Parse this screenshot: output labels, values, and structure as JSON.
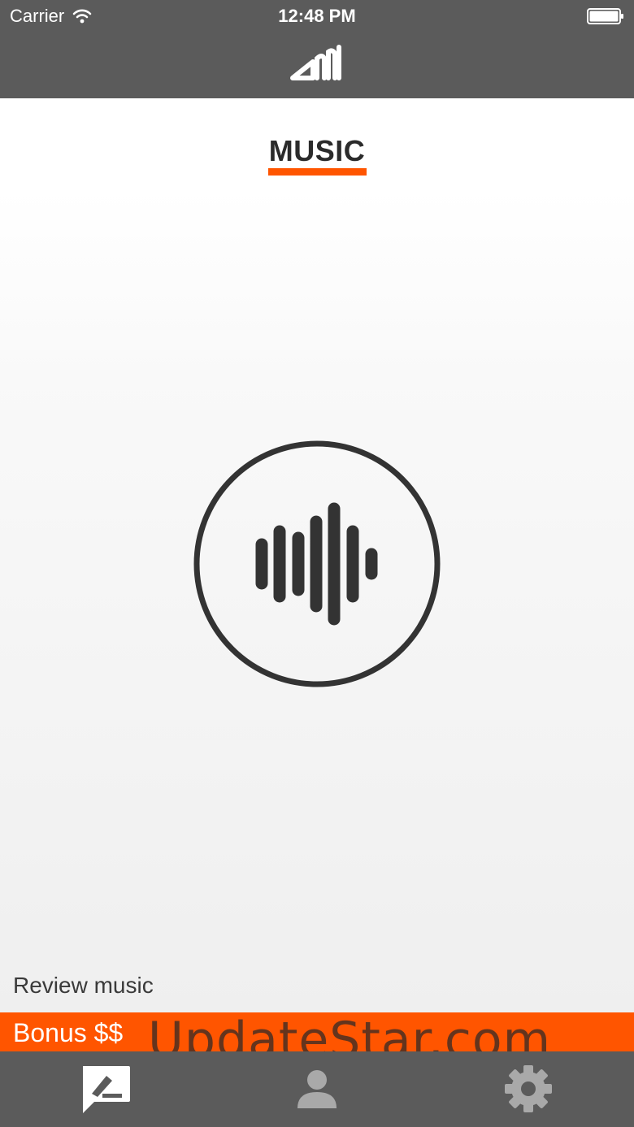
{
  "status_bar": {
    "carrier": "Carrier",
    "time": "12:48 PM",
    "wifi_icon": "wifi-icon",
    "battery_icon": "battery-icon"
  },
  "nav_bar": {
    "logo_icon": "app-logo-icon"
  },
  "main": {
    "tab_title": "MUSIC",
    "listen_icon": "soundwave-icon",
    "review_text": "Review music"
  },
  "bonus": {
    "label": "Bonus $$"
  },
  "watermark": {
    "text": "UpdateStar.com"
  },
  "tab_bar": {
    "items": [
      {
        "icon": "review-icon",
        "active": true
      },
      {
        "icon": "profile-icon",
        "active": false
      },
      {
        "icon": "settings-icon",
        "active": false
      }
    ]
  },
  "colors": {
    "accent": "#ff5500",
    "bar_background": "#5b5b5b",
    "active_icon": "#ffffff",
    "inactive_icon": "#a9a9a9",
    "text_dark": "#2b2b2b"
  }
}
